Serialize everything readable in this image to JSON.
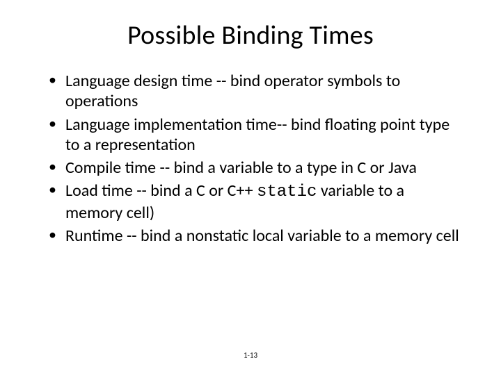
{
  "title": "Possible Binding Times",
  "bullets": [
    {
      "pre": "Language design time --  bind operator symbols to operations"
    },
    {
      "pre": "Language implementation time-- bind floating point type to a representation"
    },
    {
      "pre": "Compile time -- bind a variable to a type in C or Java"
    },
    {
      "pre": "Load time -- bind a C or C++ ",
      "code": "static",
      "post": " variable to a memory cell)"
    },
    {
      "pre": "Runtime -- bind a nonstatic local variable to a memory cell"
    }
  ],
  "page_number": "1-13"
}
